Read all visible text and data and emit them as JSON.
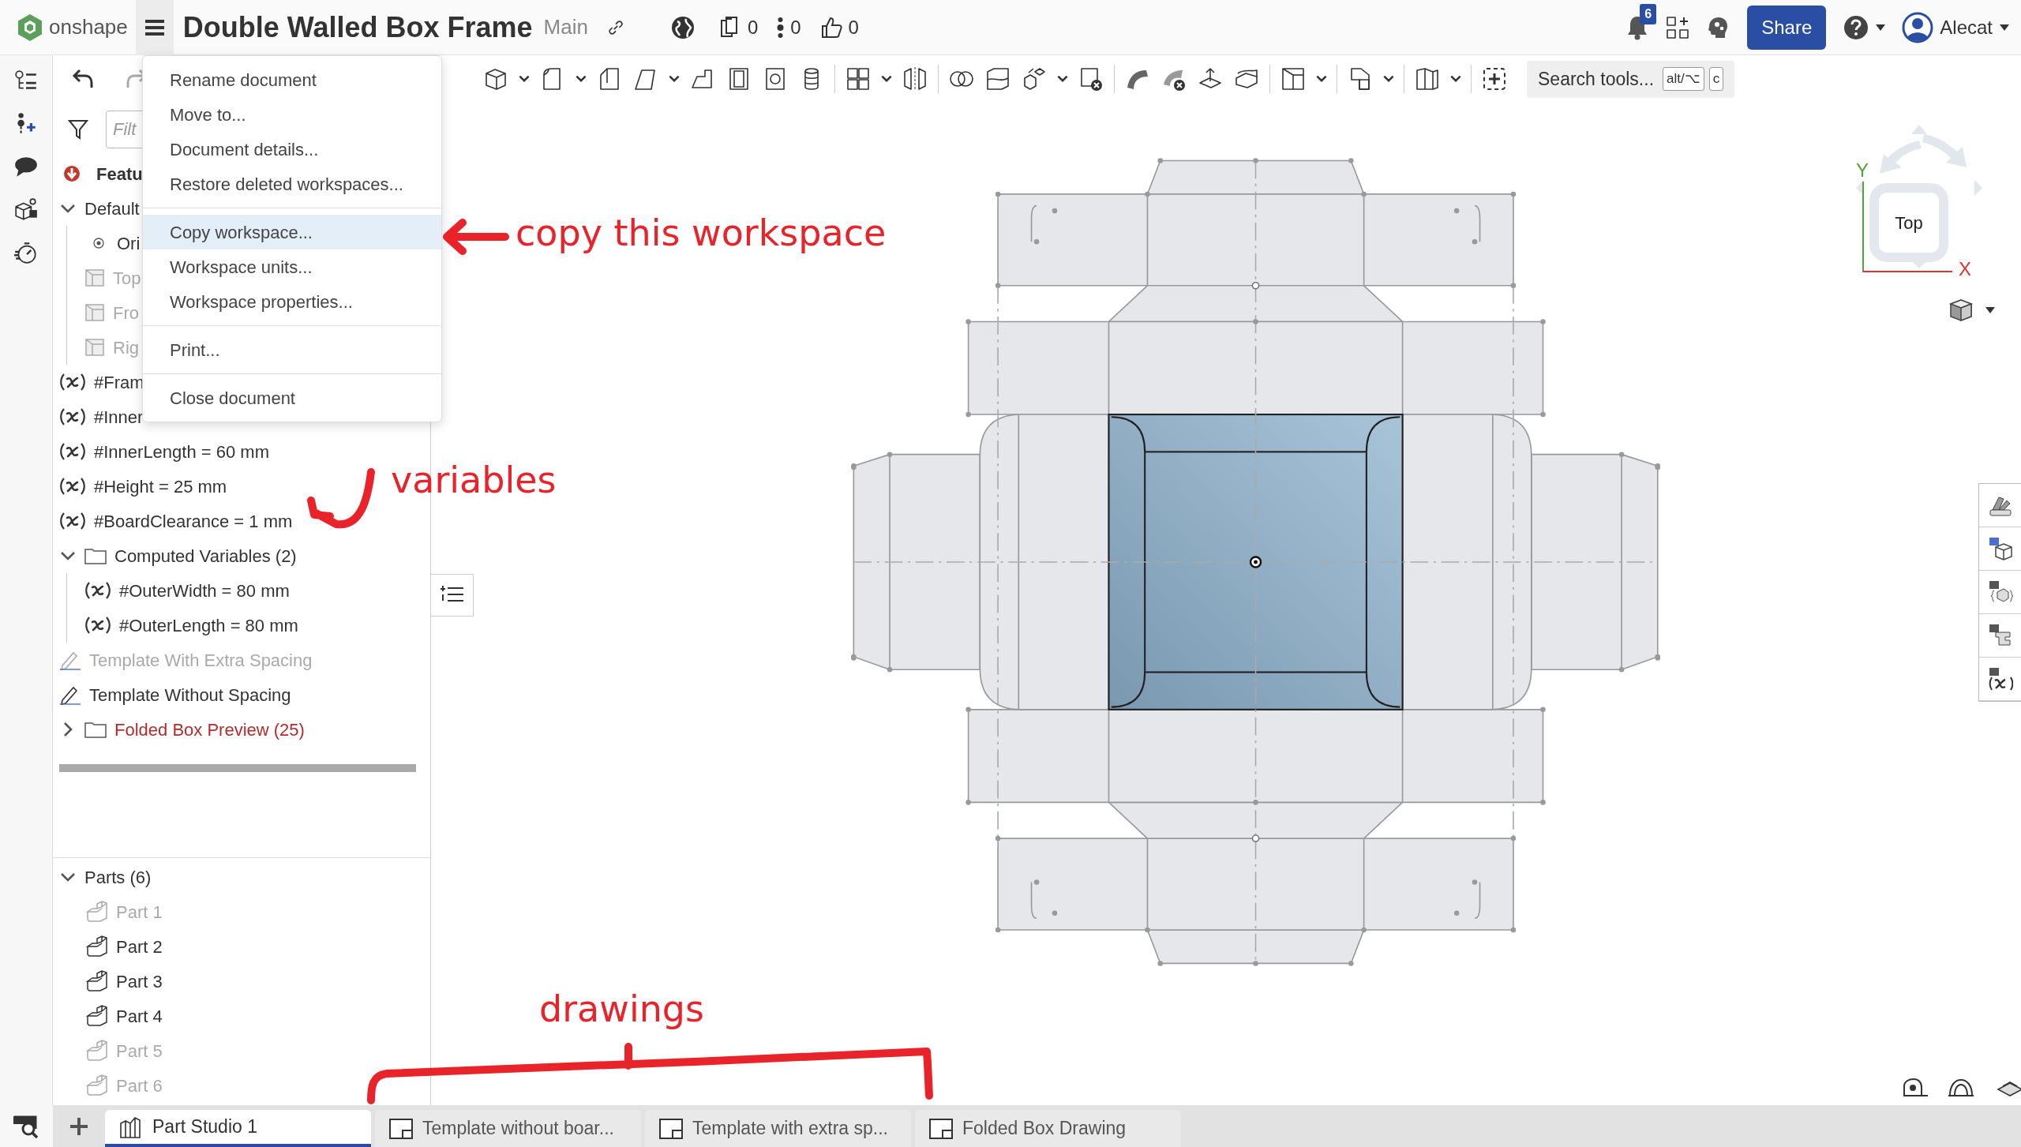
{
  "app": {
    "logo_text": "onshape"
  },
  "document": {
    "title": "Double Walled Box Frame",
    "branch": "Main",
    "counters": [
      {
        "kind": "versions",
        "value": "0"
      },
      {
        "kind": "branches",
        "value": "0"
      },
      {
        "kind": "likes",
        "value": "0"
      }
    ]
  },
  "notifications": {
    "count": "6"
  },
  "share_button": "Share",
  "user": {
    "name": "Alecat"
  },
  "search_tools": {
    "placeholder": "Search tools...",
    "shortcut_keys": [
      "alt/⌥",
      "c"
    ]
  },
  "document_menu": {
    "groups": [
      {
        "items": [
          {
            "label": "Rename document",
            "selected": false
          },
          {
            "label": "Move to...",
            "selected": false
          },
          {
            "label": "Document details...",
            "selected": false
          },
          {
            "label": "Restore deleted workspaces...",
            "selected": false
          }
        ]
      },
      {
        "items": [
          {
            "label": "Copy workspace...",
            "selected": true
          },
          {
            "label": "Workspace units...",
            "selected": false
          },
          {
            "label": "Workspace properties...",
            "selected": false
          }
        ]
      },
      {
        "items": [
          {
            "label": "Print...",
            "selected": false
          }
        ]
      },
      {
        "items": [
          {
            "label": "Close document",
            "selected": false
          }
        ]
      }
    ]
  },
  "feature_tree": {
    "filter_placeholder": "Filt",
    "header": "Featu",
    "items": [
      {
        "kind": "group",
        "name": "Default",
        "expanded": true,
        "error": false,
        "children": [
          {
            "kind": "origin",
            "name": "Ori",
            "hidden": false
          },
          {
            "kind": "plane",
            "name": "Top",
            "hidden": true
          },
          {
            "kind": "plane",
            "name": "Fro",
            "hidden": true
          },
          {
            "kind": "plane",
            "name": "Rig",
            "hidden": true
          }
        ]
      },
      {
        "kind": "variable",
        "name": "#Fram"
      },
      {
        "kind": "variable",
        "name": "#Inner"
      },
      {
        "kind": "variable",
        "name": "#InnerLength = 60 mm"
      },
      {
        "kind": "variable",
        "name": "#Height = 25 mm"
      },
      {
        "kind": "variable",
        "name": "#BoardClearance = 1 mm"
      },
      {
        "kind": "folder",
        "name": "Computed Variables (2)",
        "expanded": true,
        "error": false,
        "children": [
          {
            "kind": "variable",
            "name": "#OuterWidth = 80 mm"
          },
          {
            "kind": "variable",
            "name": "#OuterLength = 80 mm"
          }
        ]
      },
      {
        "kind": "sketch",
        "name": "Template With Extra Spacing",
        "hidden": true
      },
      {
        "kind": "sketch",
        "name": "Template Without Spacing",
        "hidden": false
      },
      {
        "kind": "folder",
        "name": "Folded Box Preview (25)",
        "expanded": false,
        "error": true
      }
    ]
  },
  "parts": {
    "header": "Parts (6)",
    "expanded": true,
    "items": [
      {
        "name": "Part 1",
        "hidden": true
      },
      {
        "name": "Part 2",
        "hidden": false
      },
      {
        "name": "Part 3",
        "hidden": false
      },
      {
        "name": "Part 4",
        "hidden": false
      },
      {
        "name": "Part 5",
        "hidden": true
      },
      {
        "name": "Part 6",
        "hidden": true
      }
    ]
  },
  "tabs": [
    {
      "kind": "part_studio",
      "label": "Part Studio 1",
      "selected": true
    },
    {
      "kind": "drawing",
      "label": "Template without boar...",
      "selected": false
    },
    {
      "kind": "drawing",
      "label": "Template with extra sp...",
      "selected": false
    },
    {
      "kind": "drawing",
      "label": "Folded Box Drawing",
      "selected": false
    }
  ],
  "view_cube": {
    "face": "Top",
    "x_label": "X",
    "y_label": "Y"
  },
  "annotations": [
    {
      "text": "copy this workspace"
    },
    {
      "text": "variables"
    },
    {
      "text": "drawings"
    }
  ]
}
